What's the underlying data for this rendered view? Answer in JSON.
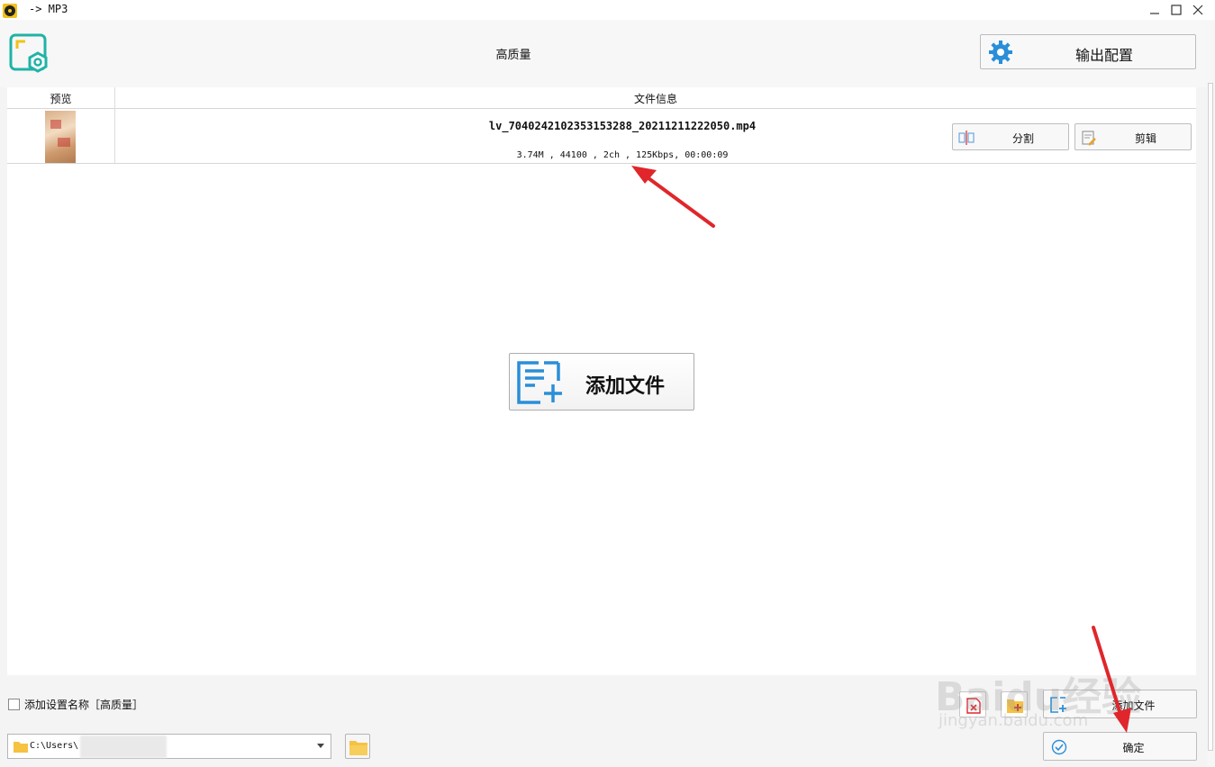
{
  "window": {
    "title": "-> MP3"
  },
  "header": {
    "preset_name": "高质量",
    "output_config_label": "输出配置"
  },
  "file_list": {
    "columns": [
      "预览",
      "文件信息"
    ],
    "rows": [
      {
        "filename": "lv_7040242102353153288_20211211222050.mp4",
        "info": "3.74M , 44100 , 2ch , 125Kbps, 00:00:09",
        "split_label": "分割",
        "edit_label": "剪辑"
      }
    ]
  },
  "center": {
    "add_file_label": "添加文件"
  },
  "bottom": {
    "add_setting_name_label": "添加设置名称［高质量］",
    "add_setting_name_checked": false,
    "output_path": "C:\\Users\\",
    "add_file_label": "添加文件",
    "confirm_label": "确定"
  },
  "watermark": {
    "brand": "Baidu经验",
    "url": "jingyan.baidu.com"
  },
  "colors": {
    "accent_blue": "#2a8ed8",
    "logo_teal": "#1fb3a6",
    "logo_yellow": "#f2c21b",
    "annotation_red": "#e0262b",
    "folder_yellow": "#f5c242"
  }
}
